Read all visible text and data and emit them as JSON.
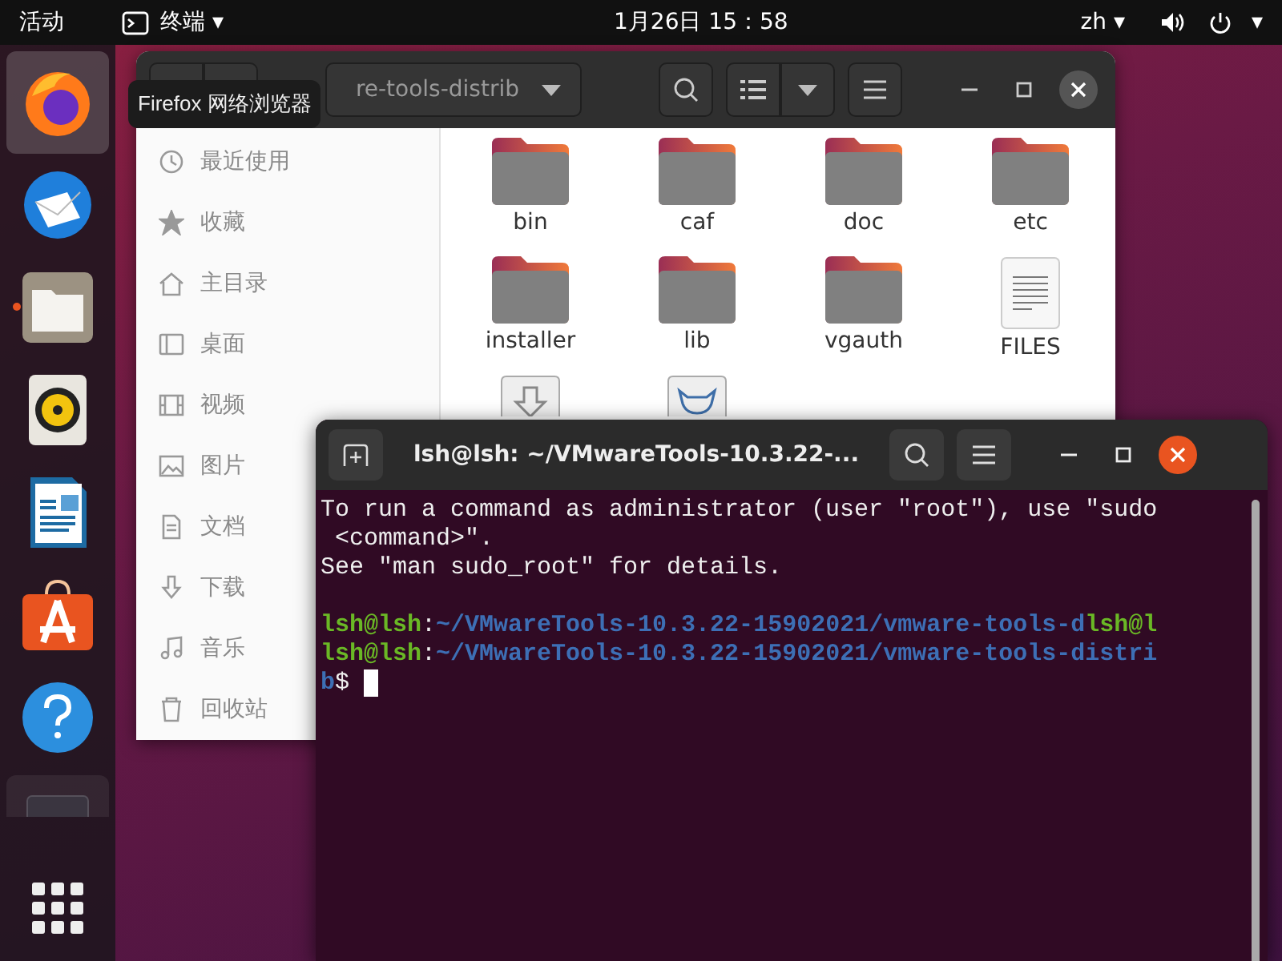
{
  "top_bar": {
    "activities": "活动",
    "app_menu": {
      "label": "终端",
      "caret": "▾"
    },
    "clock": "1月26日  15：58",
    "input_method": {
      "label": "zh",
      "caret": "▾"
    },
    "system_caret": "▾"
  },
  "dock": {
    "items": [
      {
        "selected": true,
        "running": false
      },
      {
        "selected": false,
        "running": false
      },
      {
        "selected": false,
        "running": true
      },
      {
        "selected": false,
        "running": false
      },
      {
        "selected": false,
        "running": false
      },
      {
        "selected": false,
        "running": false
      },
      {
        "selected": false,
        "running": false
      }
    ]
  },
  "tooltip": "Firefox 网络浏览器",
  "file_manager": {
    "path": "re-tools-distrib",
    "sidebar": {
      "items": [
        {
          "label": "最近使用"
        },
        {
          "label": "收藏"
        },
        {
          "label": "主目录"
        },
        {
          "label": "桌面"
        },
        {
          "label": "视频"
        },
        {
          "label": "图片"
        },
        {
          "label": "文档"
        },
        {
          "label": "下载"
        },
        {
          "label": "音乐"
        },
        {
          "label": "回收站"
        }
      ]
    },
    "files": [
      {
        "kind": "folder",
        "name": "bin"
      },
      {
        "kind": "folder",
        "name": "caf"
      },
      {
        "kind": "folder",
        "name": "doc"
      },
      {
        "kind": "folder",
        "name": "etc"
      },
      {
        "kind": "folder",
        "name": "installer"
      },
      {
        "kind": "folder",
        "name": "lib"
      },
      {
        "kind": "folder",
        "name": "vgauth"
      },
      {
        "kind": "text",
        "name": "FILES"
      },
      {
        "kind": "installer"
      },
      {
        "kind": "image"
      }
    ]
  },
  "terminal": {
    "title": "lsh@lsh: ~/VMwareTools-10.3.22-...",
    "lines": [
      {
        "kind": "text",
        "segments": [
          {
            "kind": "plain",
            "text": "To run a command as administrator (user \"root\"), use \"sudo"
          }
        ]
      },
      {
        "kind": "text",
        "segments": [
          {
            "kind": "plain",
            "text": " <command>\"."
          }
        ]
      },
      {
        "kind": "text",
        "segments": [
          {
            "kind": "plain",
            "text": "See \"man sudo_root\" for details."
          }
        ]
      },
      {
        "kind": "blank"
      },
      {
        "kind": "text",
        "segments": [
          {
            "kind": "user",
            "text": "lsh@lsh"
          },
          {
            "kind": "plain",
            "text": ":"
          },
          {
            "kind": "path",
            "text": "~/VMwareTools-10.3.22-15902021/vmware-tools-d"
          },
          {
            "kind": "user",
            "text": "lsh@l"
          }
        ]
      },
      {
        "kind": "text",
        "segments": [
          {
            "kind": "user",
            "text": "lsh@lsh"
          },
          {
            "kind": "plain",
            "text": ":"
          },
          {
            "kind": "path",
            "text": "~/VMwareTools-10.3.22-15902021/vmware-tools-distri"
          }
        ]
      },
      {
        "kind": "text",
        "segments": [
          {
            "kind": "path",
            "text": "b"
          },
          {
            "kind": "plain",
            "text": "$ "
          },
          {
            "kind": "cursor"
          }
        ]
      }
    ]
  }
}
